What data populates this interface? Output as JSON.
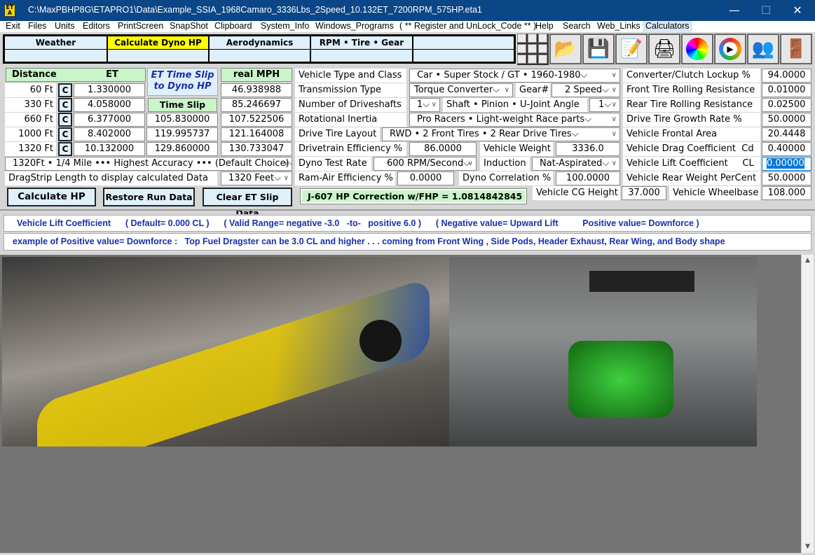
{
  "window": {
    "title": "C:\\MaxPBHP8G\\ETAPRO1\\Data\\Example_SSIA_1968Camaro_3336Lbs_2Speed_10.132ET_7200RPM_575HP.eta1",
    "app_icon": "ET A",
    "minimize": "—",
    "maximize": "☐",
    "close": "✕"
  },
  "menu": [
    "Exit",
    "Files",
    "Units",
    "Editors",
    "PrintScreen",
    "SnapShot",
    "Clipboard",
    "System_Info",
    "Windows_Programs",
    "( ** Register and UnLock_Code ** )",
    "Help",
    "Search",
    "Web_Links",
    "Calculators"
  ],
  "tabs": [
    "Weather",
    "Calculate Dyno HP",
    "Aerodynamics",
    "RPM  •  Tire  •  Gear"
  ],
  "toolbar_icons": [
    "open-folder-icon",
    "save-disk-icon",
    "notepad-icon",
    "printer-icon",
    "color-wheel-icon",
    "media-play-icon",
    "users-icon",
    "exit-door-icon"
  ],
  "et": {
    "distance_header": "Distance",
    "et_header": "ET",
    "slip_title": "ET Time Slip to Dyno HP",
    "real_mph_header": "real  MPH",
    "time_slip_mph_header": "Time Slip MPH",
    "c_label": "C",
    "rows": [
      {
        "distance": "60 Ft",
        "et": "1.330000",
        "slip_mph": "",
        "real_mph": "46.938988"
      },
      {
        "distance": "330 Ft",
        "et": "4.058000",
        "slip_mph": "",
        "real_mph": "85.246697"
      },
      {
        "distance": "660 Ft",
        "et": "6.377000",
        "slip_mph": "105.830000",
        "real_mph": "107.522506"
      },
      {
        "distance": "1000 Ft",
        "et": "8.402000",
        "slip_mph": "119.995737",
        "real_mph": "121.164008"
      },
      {
        "distance": "1320 Ft",
        "et": "10.132000",
        "slip_mph": "129.860000",
        "real_mph": "130.733047"
      }
    ],
    "accuracy_select": "1320Ft • 1/4 Mile ••• Highest Accuracy ••• (Default Choice)",
    "dragstrip_label": "DragStrip Length to display calculated Data",
    "dragstrip_select": "1320 Feet",
    "calc_button": "Calculate  HP",
    "restore_button": "Restore Run Data",
    "clear_button": "Clear ET Slip Data"
  },
  "vehicle": {
    "type_label": "Vehicle Type and Class",
    "type_value": "Car  •  Super Stock / GT  •  1960-1980",
    "trans_label": "Transmission Type",
    "trans_value": "Torque Converter",
    "gear_label": "Gear#",
    "gear_value": "2  Speed",
    "driveshafts_label": "Number of Driveshafts",
    "driveshafts_value": "1",
    "angle_label": "Shaft • Pinion • U-Joint Angle",
    "angle_value": "1",
    "inertia_label": "Rotational Inertia",
    "inertia_value": "Pro Racers  •  Light-weight Race parts",
    "tire_layout_label": "Drive Tire Layout",
    "tire_layout_value": "RWD • 2  Front Tires  •  2  Rear Drive Tires",
    "dt_eff_label": "Drivetrain Efficiency %",
    "dt_eff_value": "86.0000",
    "weight_label": "Vehicle Weight",
    "weight_value": "3336.0",
    "dyno_rate_label": "Dyno Test Rate",
    "dyno_rate_value": "600 RPM/Second",
    "induction_label": "Induction",
    "induction_value": "Nat-Aspirated",
    "ram_label": "Ram-Air Efficiency %",
    "ram_value": "0.0000",
    "corr_label": "Dyno Correlation %",
    "corr_value": "100.0000",
    "j607": "J-607 HP Correction w/FHP = 1.0814842845",
    "cg_label": "Vehicle CG Height",
    "cg_value": "37.000",
    "wheelbase_label": "Vehicle Wheelbase",
    "wheelbase_value": "108.000"
  },
  "right": [
    {
      "label": "Converter/Clutch Lockup %",
      "value": "94.0000"
    },
    {
      "label": "Front Tire Rolling Resistance",
      "value": "0.01000"
    },
    {
      "label": "Rear Tire Rolling Resistance",
      "value": "0.02500"
    },
    {
      "label": "Drive Tire Growth Rate %",
      "value": "50.0000"
    },
    {
      "label": "Vehicle Frontal Area",
      "value": "20.4448"
    },
    {
      "label": "Vehicle Drag Coefficient  Cd",
      "value": "0.40000"
    },
    {
      "label": "Vehicle Lift Coefficient     CL",
      "value": "0.00000"
    },
    {
      "label": "Vehicle Rear Weight PerCent",
      "value": "50.0000"
    }
  ],
  "info": {
    "line1": "Vehicle Lift Coefficient      ( Default= 0.000 CL )      ( Valid Range= negative -3.0   -to-   positive 6.0 )      ( Negative value= Upward Lift          Positive value= Downforce )",
    "line2": "example of Positive value= Downforce :   Top Fuel Dragster can be 3.0 CL and higher . . . coming from Front Wing , Side Pods, Header Exhaust, Rear Wing, and Body shape"
  },
  "colors": {
    "title_bar": "#0b4686",
    "highlight_tab": "#ffff00",
    "header_green": "#c9f5c9",
    "info_text": "#1a2fa8",
    "selected_input": "#0078d7"
  }
}
